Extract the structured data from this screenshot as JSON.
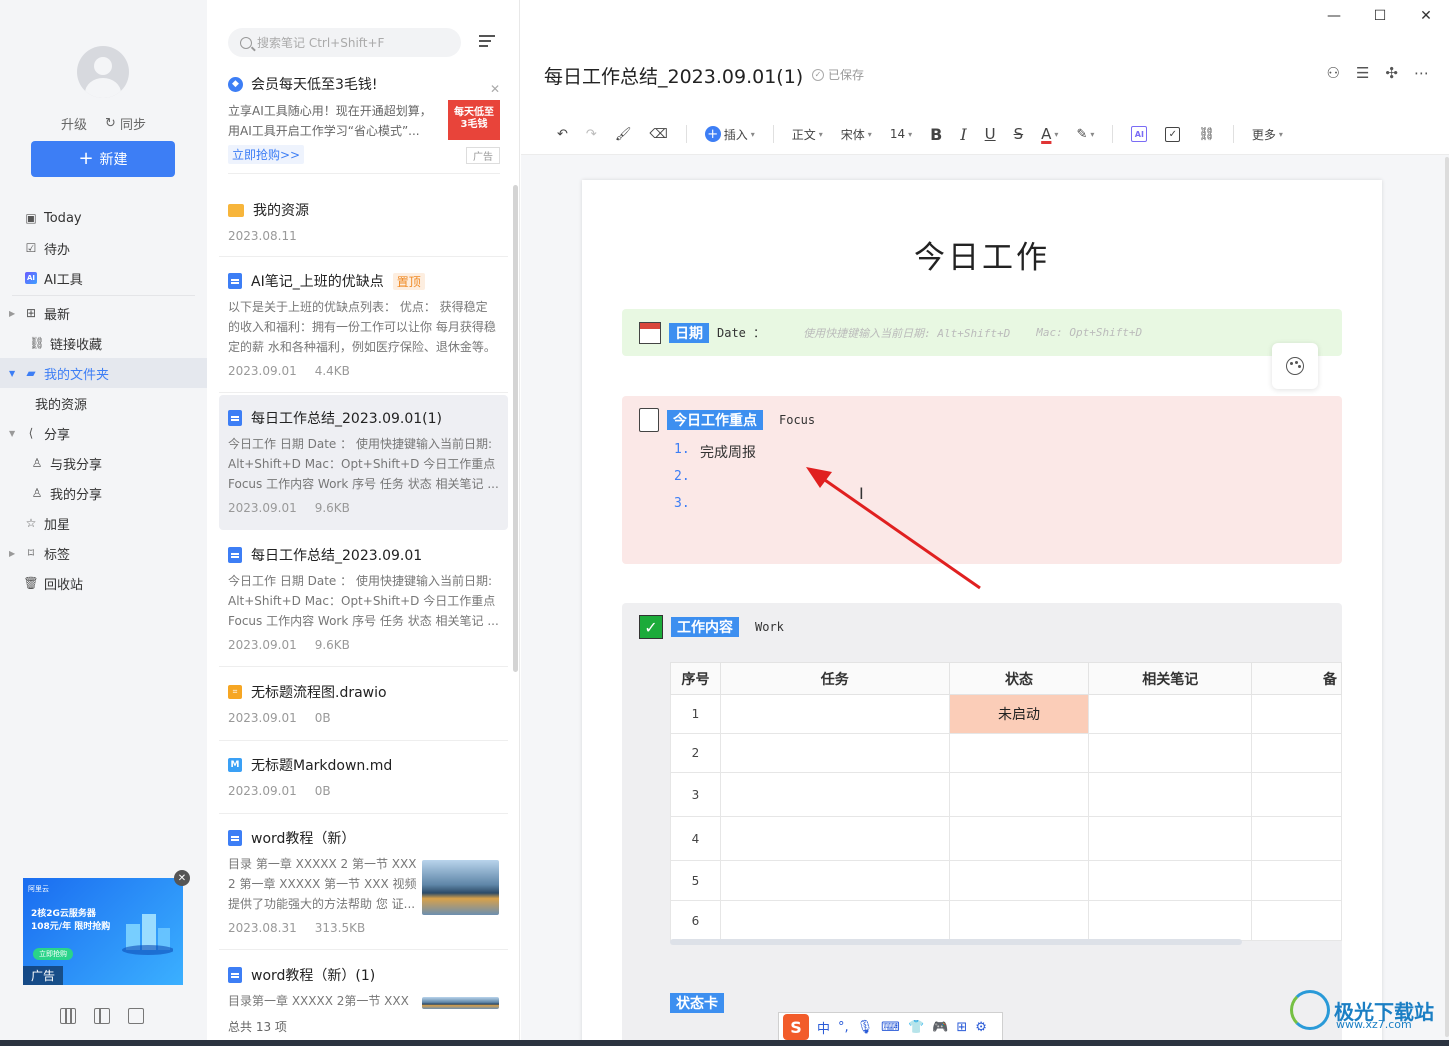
{
  "sidebar": {
    "upgrade": "升级",
    "sync": "同步",
    "new_button": "新建",
    "nav": [
      {
        "label": "Today",
        "icon": "calendar-icon"
      },
      {
        "label": "待办",
        "icon": "checkbox-icon"
      },
      {
        "label": "AI工具",
        "icon": "ai-icon"
      },
      {
        "label": "最新",
        "icon": "grid-icon"
      },
      {
        "label": "链接收藏",
        "icon": "link-icon"
      },
      {
        "label": "我的文件夹",
        "icon": "folder-icon"
      },
      {
        "label": "我的资源",
        "icon": ""
      },
      {
        "label": "分享",
        "icon": "share-icon"
      },
      {
        "label": "与我分享",
        "icon": "user-icon"
      },
      {
        "label": "我的分享",
        "icon": "user-icon"
      },
      {
        "label": "加星",
        "icon": "star-icon"
      },
      {
        "label": "标签",
        "icon": "tag-icon"
      },
      {
        "label": "回收站",
        "icon": "trash-icon"
      }
    ],
    "ad": {
      "brand": "阿里云",
      "title_line1": "2核2G云服务器",
      "title_line2": "108元/年 限时抢购",
      "button": "立即抢购",
      "tag": "广告"
    }
  },
  "list": {
    "search_placeholder": "搜索笔记 Ctrl+Shift+F",
    "promo": {
      "title": "会员每天低至3毛钱!",
      "desc": "立享AI工具随心用！现在开通超划算，用AI工具开启工作学习“省心模式”...",
      "image_text_1": "每天低至",
      "image_text_2": "3毛钱",
      "link": "立即抢购>>",
      "ad_tag": "广告"
    },
    "notes": [
      {
        "title": "我的资源",
        "date": "2023.08.11",
        "size": "",
        "desc": "",
        "pinned": ""
      },
      {
        "title": "AI笔记_上班的优缺点",
        "pinned": "置顶",
        "desc": "以下是关于上班的优缺点列表： 优点： 获得稳定的收入和福利：拥有一份工作可以让你 每月获得稳定的薪 水和各种福利，例如医疗保险、退休金等。 ...",
        "date": "2023.09.01",
        "size": "4.4KB"
      },
      {
        "title": "每日工作总结_2023.09.01(1)",
        "pinned": "",
        "desc": "今日工作 日期 Date ： 使用快捷键输入当前日期: Alt+Shift+D Mac：Opt+Shift+D 今日工作重点 Focus 工作内容 Work 序号 任务 状态 相关笔记 ...",
        "date": "2023.09.01",
        "size": "9.6KB"
      },
      {
        "title": "每日工作总结_2023.09.01",
        "pinned": "",
        "desc": "今日工作 日期 Date ： 使用快捷键输入当前日期: Alt+Shift+D Mac：Opt+Shift+D 今日工作重点 Focus 工作内容 Work 序号 任务 状态 相关笔记 ...",
        "date": "2023.09.01",
        "size": "9.6KB"
      },
      {
        "title": "无标题流程图.drawio",
        "pinned": "",
        "desc": "",
        "date": "2023.09.01",
        "size": "0B"
      },
      {
        "title": "无标题Markdown.md",
        "pinned": "",
        "desc": "",
        "date": "2023.09.01",
        "size": "0B"
      },
      {
        "title": "word教程（新）",
        "pinned": "",
        "desc": "目录 第一章 XXXXX 2 第一节 XXX 2 第一章 XXXXX 第一节 XXX 视频提供了功能强大的方法帮助 您 证...",
        "date": "2023.08.31",
        "size": "313.5KB"
      },
      {
        "title": "word教程（新）(1)",
        "pinned": "",
        "desc": "目录第一章 XXXXX 2第一节 XXX",
        "date": "",
        "size": ""
      }
    ],
    "footer": "总共 13 项"
  },
  "editor": {
    "title": "每日工作总结_2023.09.01(1)",
    "saved": "已保存",
    "toolbar": {
      "insert": "插入",
      "paragraph": "正文",
      "font": "宋体",
      "size": "14",
      "more": "更多"
    },
    "page": {
      "title": "今日工作",
      "date_label": "日期",
      "date_en": "Date ：",
      "date_placeholder_1": "使用快捷键输入当前日期: Alt+Shift+D",
      "date_placeholder_2": "Mac: Opt+Shift+D",
      "focus_label": "今日工作重点",
      "focus_en": "Focus",
      "focus_items": [
        {
          "num": "1.",
          "text": "完成周报"
        },
        {
          "num": "2.",
          "text": ""
        },
        {
          "num": "3.",
          "text": ""
        }
      ],
      "work_label": "工作内容",
      "work_en": "Work",
      "table_headers": [
        "序号",
        "任务",
        "状态",
        "相关笔记",
        "备"
      ],
      "table_rows": [
        [
          "1",
          "",
          "未启动",
          "",
          ""
        ],
        [
          "2",
          "",
          "",
          "",
          ""
        ],
        [
          "3",
          "",
          "",
          "",
          ""
        ],
        [
          "4",
          "",
          "",
          "",
          ""
        ],
        [
          "5",
          "",
          "",
          "",
          ""
        ],
        [
          "6",
          "",
          "",
          "",
          ""
        ]
      ],
      "status_label": "状态卡"
    }
  },
  "ime": {
    "logo": "S",
    "mode": "中"
  },
  "watermark": {
    "name": "极光下载站",
    "url": "www.xz7.com"
  },
  "colors": {
    "accent": "#3d7ef5",
    "date_block": "#e8f8e2",
    "focus_block": "#fbe8e7",
    "work_block": "#efeff1",
    "status_cell": "#fbcdb8",
    "arrow": "#e02020"
  }
}
